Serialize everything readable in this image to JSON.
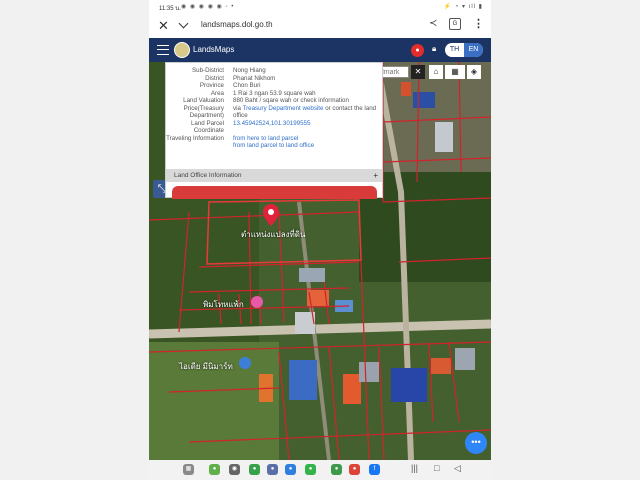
{
  "status": {
    "time": "11:35 น.",
    "notifications": "◉ ◉ ◉ ◉ ◉ ◦ •",
    "system": "⚡ ◔ ▾ ıll ▮"
  },
  "browser": {
    "url": "landsmaps.dol.go.th"
  },
  "app": {
    "title": "LandsMaps",
    "lang_th": "TH",
    "lang_en": "EN"
  },
  "search": {
    "placeholder": "Search for Landmark"
  },
  "parcel": {
    "rows": [
      {
        "key": "Sub-District",
        "value": "Nong Hiang"
      },
      {
        "key": "District",
        "value": "Phanat Nikhom"
      },
      {
        "key": "Province",
        "value": "Chon Buri"
      },
      {
        "key": "Area",
        "value": "1 Rai 3 ngan 53.9 square wah"
      },
      {
        "key": "Land Valuation",
        "value": "880 Baht / sqare wah or check information"
      }
    ],
    "price_key": "Price(Treasury Department)",
    "price_prefix": "via",
    "price_link": "Treasury Department website",
    "price_suffix": "or contact the land office",
    "land_parcel_key": "Land Parcel Coordinate",
    "land_parcel_value": "13.45942524,101.30199555",
    "travel_key": "Traveling Information",
    "travel_link_1": "from here to land parcel",
    "travel_link_2": "from land parcel to land office",
    "land_office": "Land Office Information",
    "land_office_toggle": "+"
  },
  "map_labels": {
    "parcel_label": "ตำแหน่งแปลงที่ดิน",
    "shop": "พิมโทหแพ้ก",
    "place": "ไอเดีย มีนิมาร์ท"
  },
  "colors": {
    "header": "#1c3463",
    "accent": "#3b6fc4",
    "marker": "#e0223a",
    "fab": "#2f86f6",
    "parcel_lines": "#d0242c"
  },
  "icons": [
    "close-icon",
    "chevron-down-icon",
    "share-icon",
    "translate-icon",
    "more-icon",
    "menu-icon",
    "record-icon",
    "lock-icon",
    "home-icon",
    "grid-icon",
    "layers-icon",
    "ruler-icon",
    "map-pin-icon",
    "more-dots-icon"
  ]
}
